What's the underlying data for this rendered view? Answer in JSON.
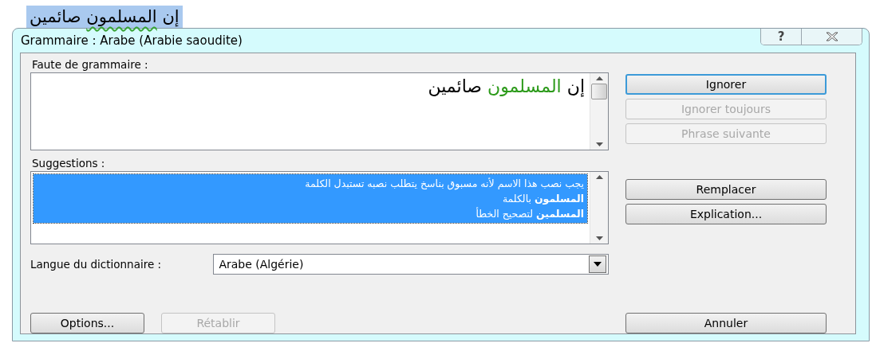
{
  "document_text": {
    "words": [
      {
        "text": "إن",
        "flagged": false
      },
      {
        "text": "المسلمون",
        "flagged": true
      },
      {
        "text": "صائمين",
        "flagged": false
      }
    ],
    "selected": true
  },
  "window": {
    "title": "Grammaire : Arabe (Arabie saoudite)",
    "help_button": "?"
  },
  "error_label": "Faute de grammaire :",
  "error_sentence": [
    {
      "text": "إن",
      "flagged": false
    },
    {
      "text": "المسلمون",
      "flagged": true
    },
    {
      "text": "صائمين",
      "flagged": false
    }
  ],
  "side_buttons": [
    {
      "label": "Ignorer",
      "disabled": false,
      "default": true
    },
    {
      "label": "Ignorer toujours",
      "disabled": true,
      "default": false
    },
    {
      "label": "Phrase suivante",
      "disabled": true,
      "default": false
    }
  ],
  "suggestions_label": "Suggestions :",
  "suggestions": [
    {
      "lines": [
        "يجب نصب هذا الاسم لأنه مسبوق بناسخ يتطلب نصبه  تستبدل الكلمة",
        "**المسلمون** بالكلمة",
        "**المسلمين** لتصحيح الخطأ"
      ],
      "selected": true
    }
  ],
  "suggestion_buttons": [
    {
      "label": "Remplacer",
      "disabled": false
    },
    {
      "label": "Explication...",
      "disabled": false
    }
  ],
  "language": {
    "label": "Langue du dictionnaire :",
    "value": "Arabe (Algérie)"
  },
  "options_button": {
    "label": "Options...",
    "disabled": false
  },
  "restore_button": {
    "label": "Rétablir",
    "disabled": true
  },
  "cancel_button": {
    "label": "Annuler",
    "disabled": false
  }
}
